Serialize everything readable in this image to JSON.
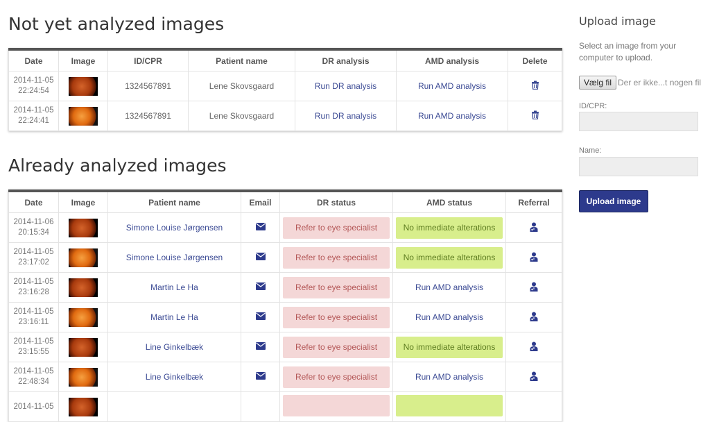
{
  "pending": {
    "title": "Not yet analyzed images",
    "columns": [
      "Date",
      "Image",
      "ID/CPR",
      "Patient name",
      "DR analysis",
      "AMD analysis",
      "Delete"
    ],
    "rows": [
      {
        "date": "2014-11-05",
        "time": "22:24:54",
        "cpr": "1324567891",
        "name": "Lene Skovsgaard",
        "dr": "Run DR analysis",
        "amd": "Run AMD analysis"
      },
      {
        "date": "2014-11-05",
        "time": "22:24:41",
        "cpr": "1324567891",
        "name": "Lene Skovsgaard",
        "dr": "Run DR analysis",
        "amd": "Run AMD analysis"
      }
    ]
  },
  "analyzed": {
    "title": "Already analyzed images",
    "columns": [
      "Date",
      "Image",
      "Patient name",
      "Email",
      "DR status",
      "AMD status",
      "Referral"
    ],
    "rows": [
      {
        "date": "2014-11-06",
        "time": "20:15:34",
        "name": "Simone Louise Jørgensen",
        "dr": "Refer to eye specialist",
        "amd": "No immediate alterations",
        "amd_type": "badge"
      },
      {
        "date": "2014-11-05",
        "time": "23:17:02",
        "name": "Simone Louise Jørgensen",
        "dr": "Refer to eye specialist",
        "amd": "No immediate alterations",
        "amd_type": "badge"
      },
      {
        "date": "2014-11-05",
        "time": "23:16:28",
        "name": "Martin Le Ha",
        "dr": "Refer to eye specialist",
        "amd": "Run AMD analysis",
        "amd_type": "link"
      },
      {
        "date": "2014-11-05",
        "time": "23:16:11",
        "name": "Martin Le Ha",
        "dr": "Refer to eye specialist",
        "amd": "Run AMD analysis",
        "amd_type": "link"
      },
      {
        "date": "2014-11-05",
        "time": "23:15:55",
        "name": "Line Ginkelbæk",
        "dr": "Refer to eye specialist",
        "amd": "No immediate alterations",
        "amd_type": "badge"
      },
      {
        "date": "2014-11-05",
        "time": "22:48:34",
        "name": "Line Ginkelbæk",
        "dr": "Refer to eye specialist",
        "amd": "Run AMD analysis",
        "amd_type": "link"
      },
      {
        "date": "2014-11-05",
        "time": "",
        "name": "",
        "dr": "",
        "amd": "",
        "amd_type": "badge"
      }
    ]
  },
  "upload": {
    "title": "Upload image",
    "description": "Select an image from your computer to upload.",
    "file_button": "Vælg fil",
    "file_status": "Der er ikke...t nogen fil",
    "cpr_label": "ID/CPR:",
    "name_label": "Name:",
    "submit": "Upload image"
  },
  "icons": {
    "delete": "trash-icon",
    "email": "envelope-icon",
    "referral": "doctor-icon"
  },
  "colors": {
    "accent": "#2d3a8c",
    "link": "#3b4a94",
    "dr_bg": "#f4d7d7",
    "dr_text": "#b45858",
    "amd_bg": "#d8ee8c",
    "amd_text": "#5b7a1e"
  }
}
